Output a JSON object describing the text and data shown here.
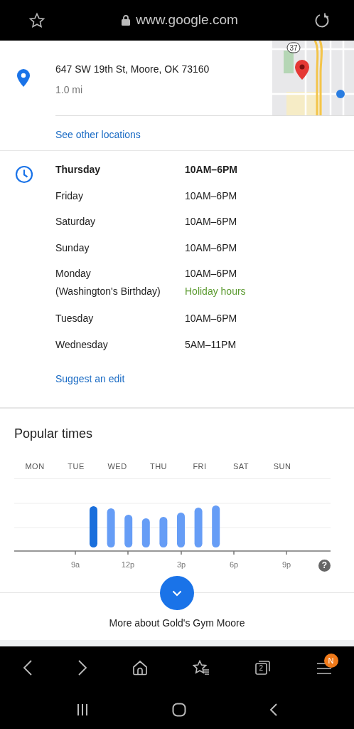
{
  "browser": {
    "url": "www.google.com"
  },
  "location": {
    "address": "647 SW 19th St, Moore, OK 73160",
    "distance": "1.0 mi",
    "map": {
      "kind": "picture",
      "route_shield": "37"
    },
    "link": "See other locations"
  },
  "hours": [
    {
      "day": "Thursday",
      "time": "10AM–6PM",
      "today": true
    },
    {
      "day": "Friday",
      "time": "10AM–6PM",
      "today": false
    },
    {
      "day": "Saturday",
      "time": "10AM–6PM",
      "today": false
    },
    {
      "day": "Sunday",
      "time": "10AM–6PM",
      "today": false
    },
    {
      "day": "Monday",
      "time": "10AM–6PM",
      "today": false,
      "holiday": "(Washington's Birthday)",
      "note": "Holiday hours"
    },
    {
      "day": "Tuesday",
      "time": "10AM–6PM",
      "today": false
    },
    {
      "day": "Wednesday",
      "time": "5AM–11PM",
      "today": false
    }
  ],
  "suggest_link": "Suggest an edit",
  "popular_times": {
    "title": "Popular times",
    "days": [
      "MON",
      "TUE",
      "WED",
      "THU",
      "FRI",
      "SAT",
      "SUN"
    ],
    "hour_labels": [
      "9a",
      "12p",
      "3p",
      "6p",
      "9p"
    ],
    "help": "?"
  },
  "more_link": "More about Gold's Gym Moore",
  "browser_toolbar": {
    "tab_count": "2",
    "menu_badge": "N"
  }
}
